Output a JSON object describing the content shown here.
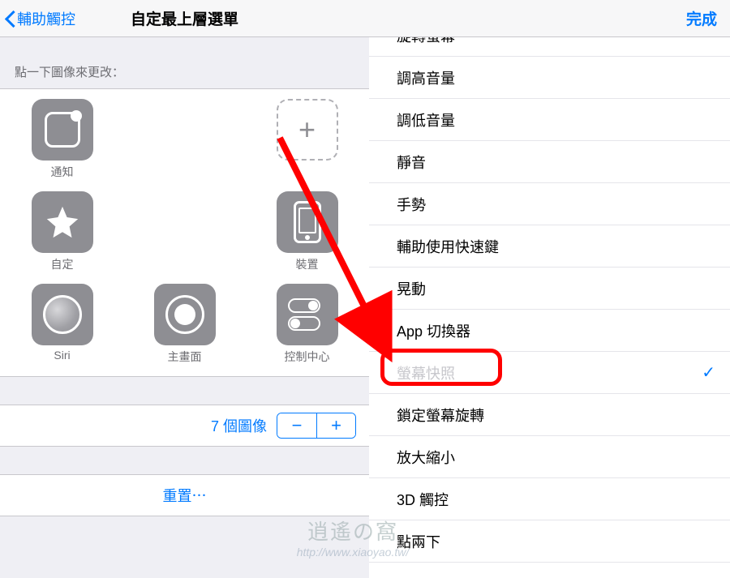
{
  "left": {
    "back_label": "輔助觸控",
    "title": "自定最上層選單",
    "hint": "點一下圖像來更改：",
    "tiles": [
      {
        "label": "通知",
        "icon": "notif"
      },
      {
        "label": "",
        "icon": "empty-placeholder-hidden"
      },
      {
        "label": "",
        "icon": "empty"
      },
      {
        "label": "自定",
        "icon": "star"
      },
      {
        "label": "",
        "icon": "empty-placeholder-hidden"
      },
      {
        "label": "裝置",
        "icon": "device"
      },
      {
        "label": "Siri",
        "icon": "siri"
      },
      {
        "label": "主畫面",
        "icon": "home"
      },
      {
        "label": "控制中心",
        "icon": "cc"
      }
    ],
    "count_label": "7 個圖像",
    "stepper_minus": "−",
    "stepper_plus": "+",
    "reset": "重置⋯"
  },
  "right": {
    "done": "完成",
    "options": [
      "旋轉螢幕",
      "調高音量",
      "調低音量",
      "靜音",
      "手勢",
      "輔助使用快速鍵",
      "晃動",
      "App 切換器",
      "螢幕快照",
      "鎖定螢幕旋轉",
      "放大縮小",
      "3D 觸控",
      "點兩下"
    ],
    "selected_index": 8
  },
  "watermark": {
    "line1": "逍遙の窩",
    "line2": "http://www.xiaoyao.tw/"
  }
}
